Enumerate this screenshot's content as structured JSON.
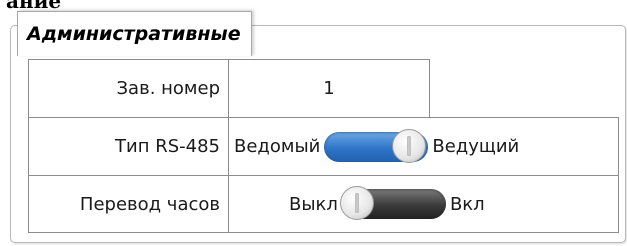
{
  "top_cut_text": "ание",
  "group": {
    "title": "Административные"
  },
  "rows": [
    {
      "label": "Зав. номер",
      "value": "1"
    },
    {
      "label": "Тип RS-485",
      "left_option": "Ведомый",
      "right_option": "Ведущий",
      "state": "on"
    },
    {
      "label": "Перевод часов",
      "left_option": "Выкл",
      "right_option": "Вкл",
      "state": "off"
    }
  ],
  "colors": {
    "toggle_on": "#2d74c8",
    "toggle_off": "#3a3a3a",
    "grid_border": "#8c8c8c"
  }
}
